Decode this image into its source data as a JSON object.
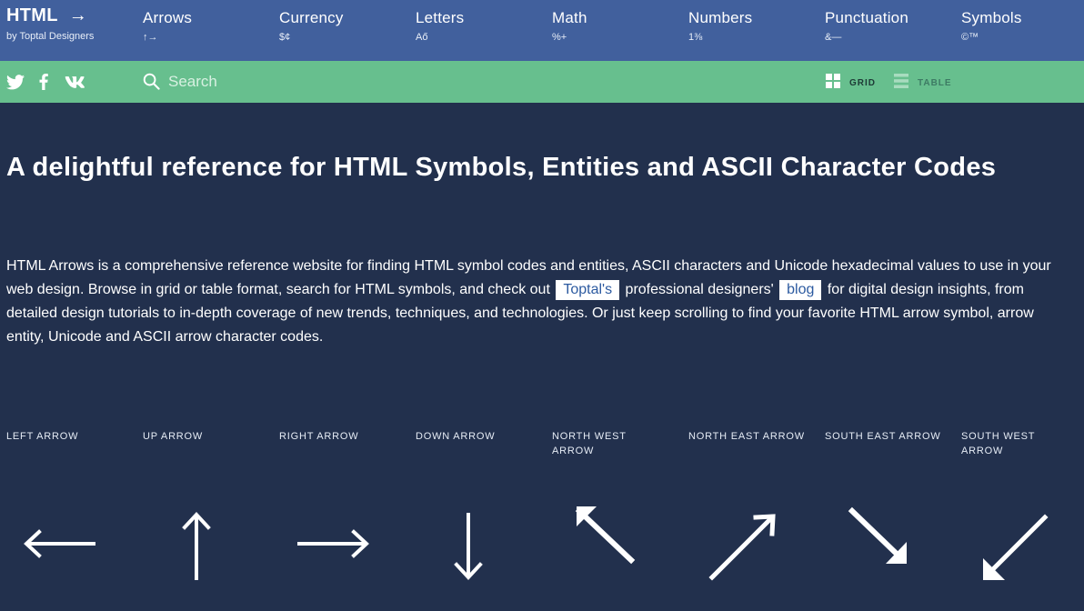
{
  "brand": {
    "title": "HTML",
    "arrow": "→",
    "subtitle": "by Toptal Designers"
  },
  "nav": [
    {
      "label": "Arrows",
      "sample": "↑→"
    },
    {
      "label": "Currency",
      "sample": "$¢"
    },
    {
      "label": "Letters",
      "sample": "Aő"
    },
    {
      "label": "Math",
      "sample": "%+"
    },
    {
      "label": "Numbers",
      "sample": "1⅜"
    },
    {
      "label": "Punctuation",
      "sample": "&—"
    },
    {
      "label": "Symbols",
      "sample": "©™"
    }
  ],
  "social": [
    "twitter-icon",
    "facebook-icon",
    "vk-icon"
  ],
  "search": {
    "placeholder": "Search",
    "value": ""
  },
  "view": {
    "grid_label": "GRID",
    "table_label": "TABLE",
    "active": "grid"
  },
  "headline": "A delightful reference for HTML Symbols, Entities and ASCII Character Codes",
  "intro": {
    "part1": "HTML Arrows is a comprehensive reference website for finding HTML symbol codes and entities, ASCII characters and Unicode hexadecimal values to use in your web design. Browse in grid or table format, search for HTML symbols, and check out",
    "link1": "Toptal's",
    "part2": "professional designers'",
    "link2": "blog",
    "part3": "for digital design insights, from detailed design tutorials to in-depth coverage of new trends, techniques, and technologies. Or just keep scrolling to find your favorite HTML arrow symbol, arrow entity, Unicode and ASCII arrow character codes."
  },
  "arrows": [
    {
      "label": "LEFT ARROW",
      "icon": "left-arrow-icon"
    },
    {
      "label": "UP ARROW",
      "icon": "up-arrow-icon"
    },
    {
      "label": "RIGHT ARROW",
      "icon": "right-arrow-icon"
    },
    {
      "label": "DOWN ARROW",
      "icon": "down-arrow-icon"
    },
    {
      "label": "NORTH WEST ARROW",
      "icon": "north-west-arrow-icon"
    },
    {
      "label": "NORTH EAST ARROW",
      "icon": "north-east-arrow-icon"
    },
    {
      "label": "SOUTH EAST ARROW",
      "icon": "south-east-arrow-icon"
    },
    {
      "label": "SOUTH WEST ARROW",
      "icon": "south-west-arrow-icon"
    }
  ],
  "colors": {
    "nav_bg": "#41609d",
    "search_bg": "#67bf8e",
    "page_bg": "#22304d",
    "link_text": "#2c5aa0"
  }
}
